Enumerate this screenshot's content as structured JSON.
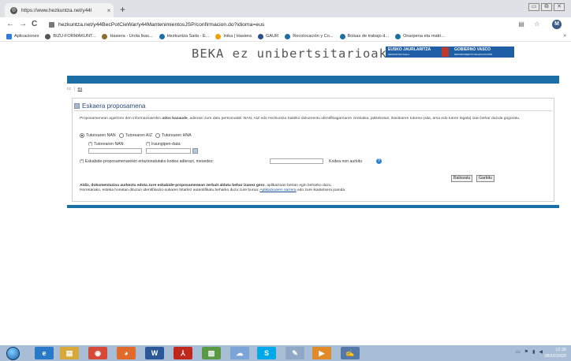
{
  "browser": {
    "tab_title": "https://www.hezkuntza.net/y44l",
    "tab_close": "×",
    "new_tab": "+",
    "window_controls": [
      "▭",
      "⧉",
      "✕"
    ],
    "nav": {
      "back": "←",
      "forward": "→",
      "reload": "C"
    },
    "url": "hezkuntza.net/y44BecPotCieWar/y44MantenimientosJSP/confirmacion.do?idioma=eus",
    "profile_initial": "M",
    "bookmarks": [
      {
        "label": "Aplicaciones",
        "color": "#2f7de1"
      },
      {
        "label": "BIZU-FORMAKUNT...",
        "color": "#555555"
      },
      {
        "label": "Hasiera - Urola Ikas...",
        "color": "#8a6d2f"
      },
      {
        "label": "Hezkuntza Saila - E...",
        "color": "#1a6fa6"
      },
      {
        "label": "Inika | Hasiera",
        "color": "#f0a000"
      },
      {
        "label": "GAUR",
        "color": "#2b4f8a"
      },
      {
        "label": "Recolocación y Co...",
        "color": "#1a6fa6"
      },
      {
        "label": "Bolsas de trabajo d...",
        "color": "#1a6fa6"
      },
      {
        "label": "Onarpena eta matri...",
        "color": "#1a6fa6"
      }
    ],
    "bookmarks_more": "»"
  },
  "site": {
    "title": "BEKA ez unibertsitarioak",
    "logo": {
      "eu_main": "EUSKO JAURLARITZA",
      "eu_sub": "HEZKUNTZA SAILA",
      "es_main": "GOBIERNO VASCO",
      "es_sub": "DEPARTAMENTO DE EDUCACIÓN"
    },
    "languages": [
      "cc",
      "eu"
    ],
    "lang_sep": "|"
  },
  "form": {
    "title": "Eskaera proposamena",
    "intro_pre": "Proposamenean agertzen den informazioarekin ",
    "intro_bold": "ados bazaude",
    "intro_post": ", adierazi zure datu pertsonalak: NAN, AIZ edo Hezkuntza Saileko dokumentu identifikagarriaren zenbakia, jakitekotan, ikaslearen tutorea (aita, ama edo tutore legala) izan behar duzula gogoratu.",
    "radio_options": [
      {
        "label": "Tutorearen NAN",
        "selected": true
      },
      {
        "label": "Tutorearen AIZ",
        "selected": false
      },
      {
        "label": "Tutorearen HNA",
        "selected": false
      }
    ],
    "nan_label": "(*) Tutorearen NAN:",
    "date_label": "(*) Iraungipen-data:",
    "nan_value": "",
    "date_value": "",
    "code_label": "(*) Eskabide-proposamenarekin erlazionatutako kodea adierazi, mesedez:",
    "code_value": "",
    "code_not_found": "Kodea non aurkitu",
    "help_glyph": "?",
    "btn_submit": "Baliozatu",
    "btn_cancel": "Garbitu",
    "notice_bold": "Aldiz, dokumentazioa aurkeztu edota zure eskabide-proposamenean zerbait aldatu behar izanez gero",
    "notice_mid": ", aplikazioan bertan egin beharko duzu.",
    "notice_line2_pre": "Horretarako, esteka honetan dituzun identifikazio-sukaren bitartez autentifikatu beharko duzu zure burua: ",
    "notice_link": "Aplikazioaren sarrera",
    "notice_line2_post": " edo zure ikastetxera joanda."
  },
  "taskbar": {
    "apps": [
      {
        "name": "ie",
        "glyph": "e",
        "color": "#2a78c8"
      },
      {
        "name": "explorer",
        "glyph": "▤",
        "color": "#d6a93a"
      },
      {
        "name": "chrome",
        "glyph": "◉",
        "color": "#d64a3a"
      },
      {
        "name": "firefox",
        "glyph": "◕",
        "color": "#e06a2a"
      },
      {
        "name": "word",
        "glyph": "W",
        "color": "#2b5797"
      },
      {
        "name": "acrobat",
        "glyph": "⅄",
        "color": "#c0281e"
      },
      {
        "name": "image",
        "glyph": "▨",
        "color": "#5a9a46"
      },
      {
        "name": "cloud",
        "glyph": "☁",
        "color": "#7aa5d6"
      },
      {
        "name": "skype",
        "glyph": "S",
        "color": "#00a8e8"
      },
      {
        "name": "pen",
        "glyph": "✎",
        "color": "#8fa8c6"
      },
      {
        "name": "media",
        "glyph": "▶",
        "color": "#e08a2a"
      },
      {
        "name": "tool",
        "glyph": "✍",
        "color": "#5478a8"
      }
    ],
    "time": "12:30",
    "date": "08/10/2020"
  }
}
